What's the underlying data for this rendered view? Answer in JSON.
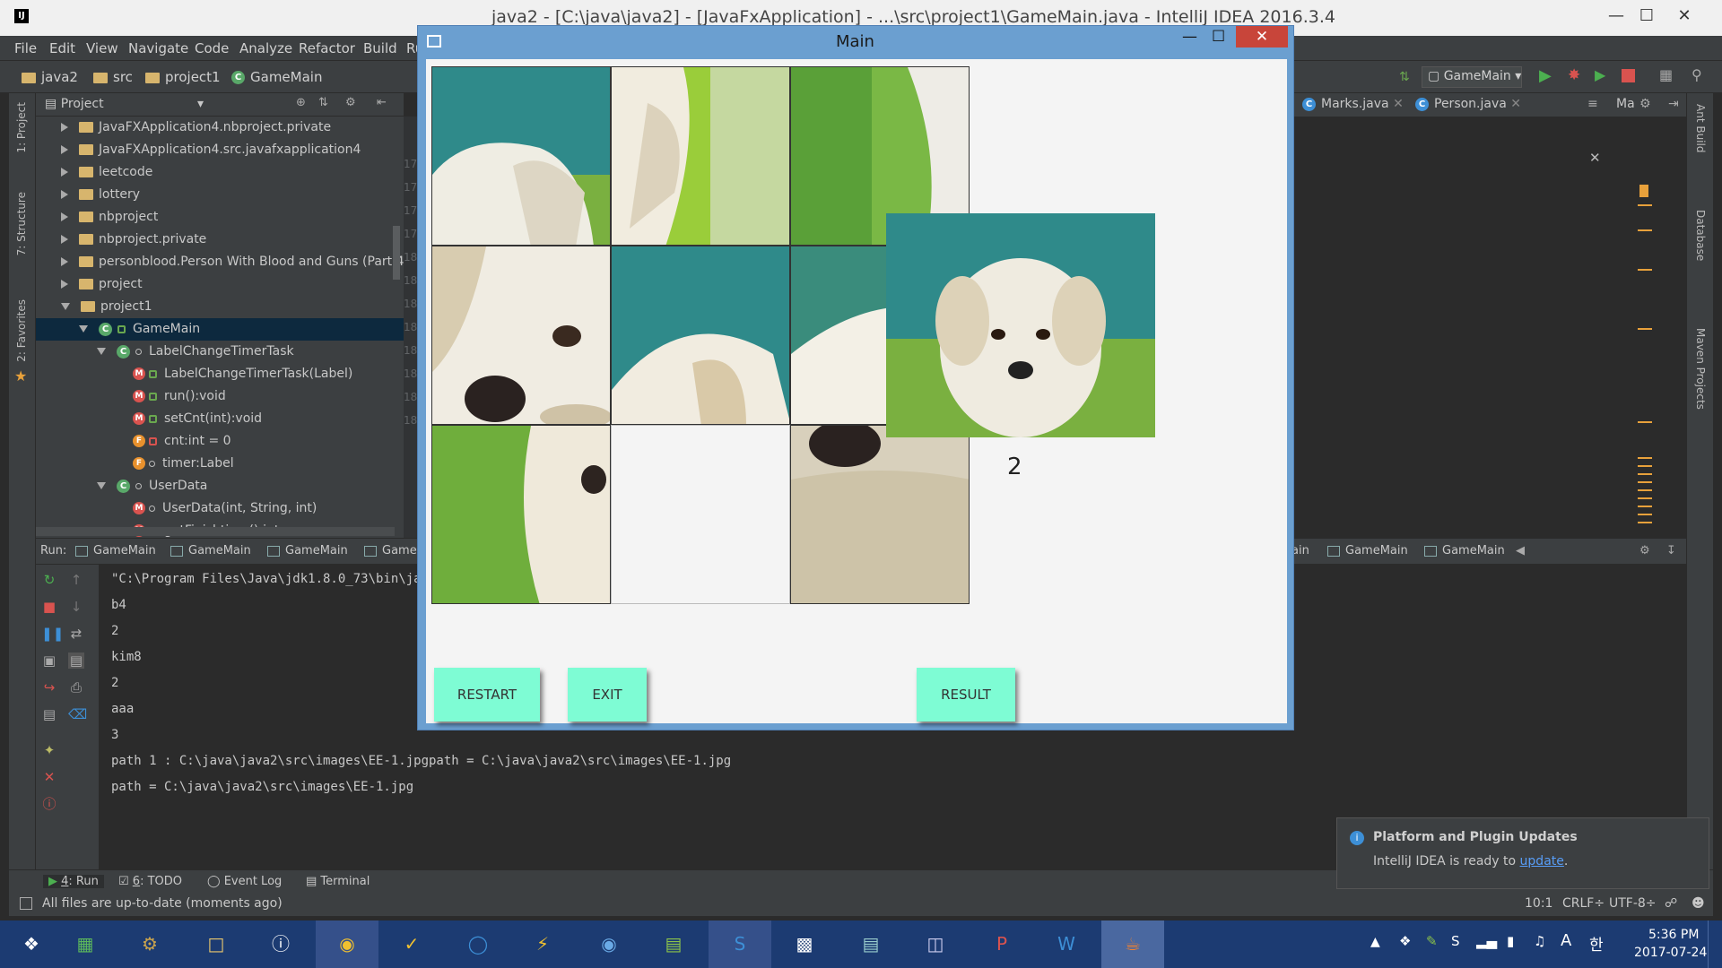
{
  "ide": {
    "title": "java2 - [C:\\java\\java2] - [JavaFxApplication] - ...\\src\\project1\\GameMain.java - IntelliJ IDEA 2016.3.4",
    "logo": "IJ",
    "menu": [
      "File",
      "Edit",
      "View",
      "Navigate",
      "Code",
      "Analyze",
      "Refactor",
      "Build",
      "Ru"
    ],
    "breadcrumbs": [
      "java2",
      "src",
      "project1",
      "GameMain"
    ],
    "run_config": "GameMain",
    "left_tabs": [
      "1: Project",
      "7: Structure",
      "2: Favorites"
    ],
    "right_tabs": [
      "Ant Build",
      "Database",
      "Maven Projects"
    ],
    "project_panel_label": "Project",
    "editor_tabs": [
      "Marks.java",
      "Person.java"
    ],
    "editor_tab_more": "Ma",
    "line_numbers": [
      "17",
      "17",
      "17",
      "17",
      "18",
      "18",
      "18",
      "18",
      "18",
      "18",
      "18",
      "18"
    ]
  },
  "tree": [
    {
      "label": "JavaFXApplication4.nbproject.private",
      "kind": "folder",
      "expand": "r",
      "indent": 0
    },
    {
      "label": "JavaFXApplication4.src.javafxapplication4",
      "kind": "folder",
      "expand": "r",
      "indent": 0
    },
    {
      "label": "leetcode",
      "kind": "folder",
      "expand": "r",
      "indent": 0
    },
    {
      "label": "lottery",
      "kind": "folder",
      "expand": "r",
      "indent": 0
    },
    {
      "label": "nbproject",
      "kind": "folder",
      "expand": "r",
      "indent": 0
    },
    {
      "label": "nbproject.private",
      "kind": "folder",
      "expand": "r",
      "indent": 0
    },
    {
      "label": "personblood.Person With Blood and Guns (Part 4",
      "kind": "folder",
      "expand": "r",
      "indent": 0
    },
    {
      "label": "project",
      "kind": "folder",
      "expand": "r",
      "indent": 0
    },
    {
      "label": "project1",
      "kind": "folder",
      "expand": "d",
      "indent": 0
    },
    {
      "label": "GameMain",
      "kind": "class",
      "expand": "d",
      "indent": 1,
      "selected": true
    },
    {
      "label": "LabelChangeTimerTask",
      "kind": "class",
      "expand": "d",
      "indent": 2
    },
    {
      "label": "LabelChangeTimerTask(Label)",
      "kind": "method",
      "indent": 3
    },
    {
      "label": "run():void",
      "kind": "method",
      "indent": 3
    },
    {
      "label": "setCnt(int):void",
      "kind": "method",
      "indent": 3
    },
    {
      "label": "cnt:int = 0",
      "kind": "field",
      "indent": 3
    },
    {
      "label": "timer:Label",
      "kind": "field",
      "indent": 3
    },
    {
      "label": "UserData",
      "kind": "class",
      "expand": "d",
      "indent": 2
    },
    {
      "label": "UserData(int, String, int)",
      "kind": "method",
      "indent": 3
    },
    {
      "label": "getFinishtime():int",
      "kind": "method",
      "indent": 3
    }
  ],
  "run": {
    "label": "Run:",
    "tabs": [
      "GameMain",
      "GameMain",
      "GameMain",
      "Game"
    ],
    "tabs_right": [
      "ain",
      "GameMain",
      "GameMain"
    ],
    "console": [
      "\"C:\\Program Files\\Java\\jdk1.8.0_73\\bin\\java",
      "b4",
      "2",
      "kim8",
      "2",
      "aaa",
      "3",
      "path 1 : C:\\java\\java2\\src\\images\\EE-1.jpgpath = C:\\java\\java2\\src\\images\\EE-1.jpg",
      "path = C:\\java\\java2\\src\\images\\EE-1.jpg"
    ]
  },
  "bottom_tabs": [
    {
      "num": "4",
      "label": ": Run"
    },
    {
      "num": "6",
      "label": ": TODO"
    },
    {
      "num": "",
      "label": "Event Log"
    },
    {
      "num": "",
      "label": "Terminal"
    }
  ],
  "status": {
    "message": "All files are up-to-date (moments ago)",
    "position": "10:1",
    "line_sep": "CRLF÷",
    "encoding": "UTF-8÷"
  },
  "notification": {
    "title": "Platform and Plugin Updates",
    "text": "IntelliJ IDEA is ready to ",
    "link": "update",
    "suffix": "."
  },
  "fx": {
    "title": "Main",
    "counter": "2",
    "buttons": {
      "restart": "RESTART",
      "exit": "EXIT",
      "result": "RESULT"
    }
  },
  "taskbar": {
    "time": "5:36 PM",
    "date": "2017-07-24",
    "ime": "한"
  },
  "colors": {
    "fx_button": "#7efcd4",
    "selection": "#0d293e",
    "taskbar": "#1c3b72"
  }
}
